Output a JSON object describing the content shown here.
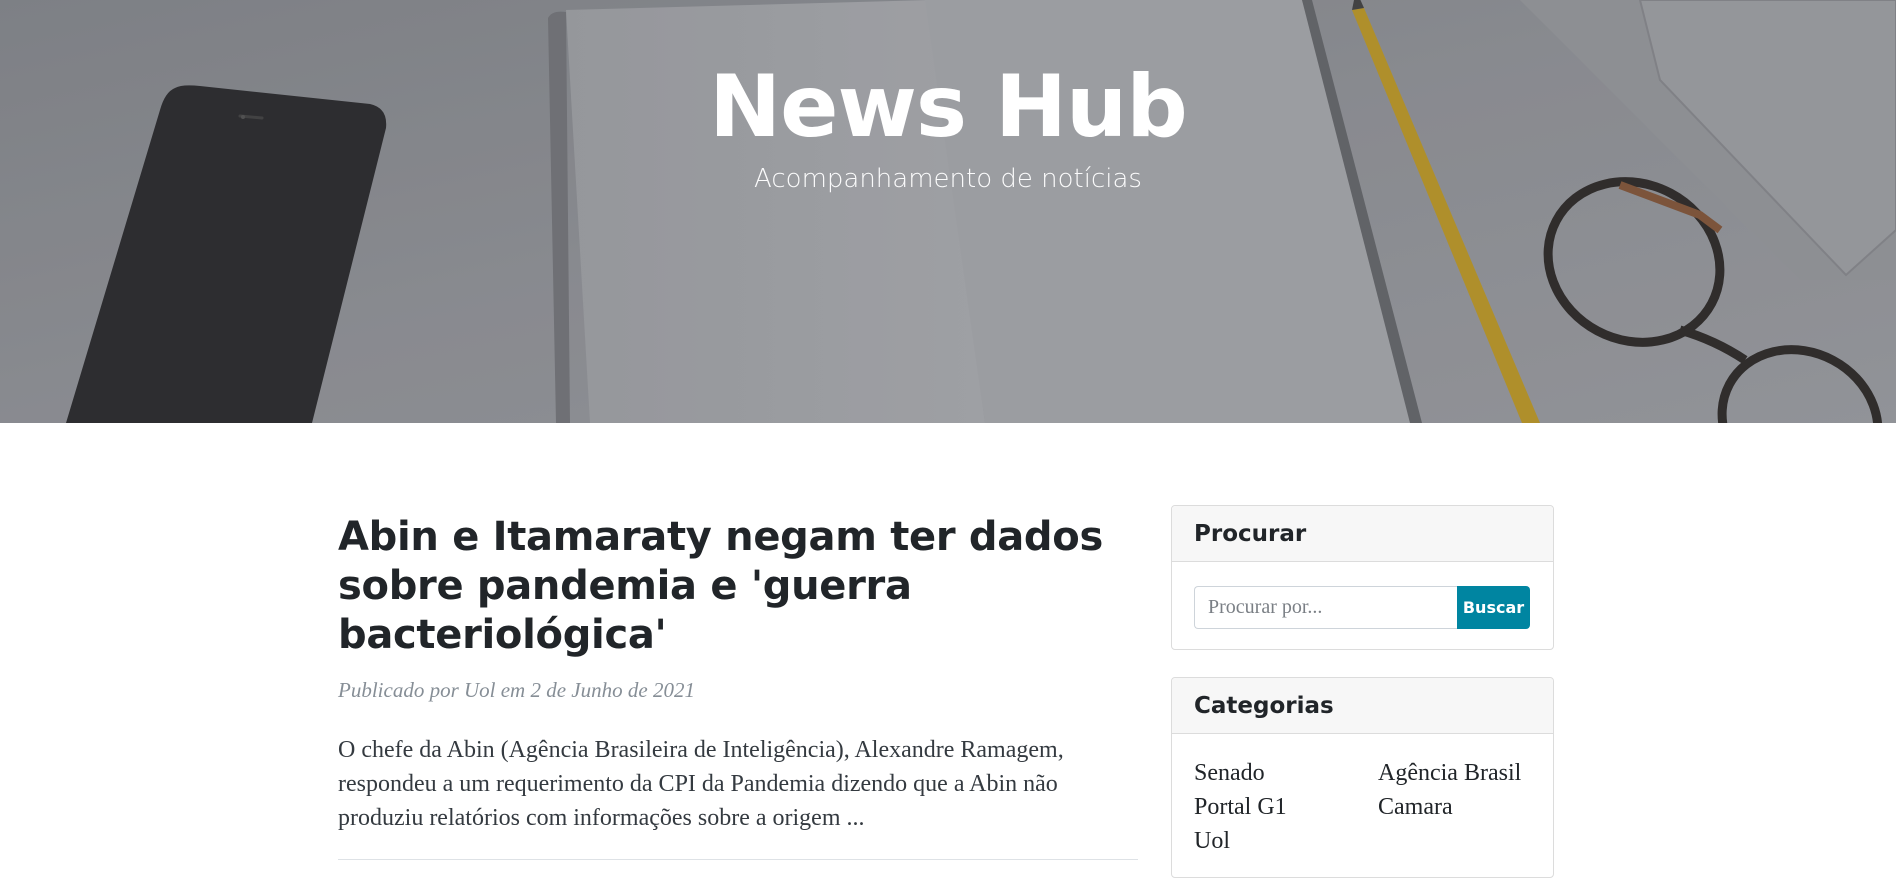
{
  "header": {
    "title": "News Hub",
    "subtitle": "Acompanhamento de notícias"
  },
  "post": {
    "title": "Abin e Itamaraty negam ter dados sobre pandemia e 'guerra bacteriológica'",
    "meta": "Publicado por Uol em 2 de Junho de 2021",
    "excerpt": "O chefe da Abin (Agência Brasileira de Inteligência), Alexandre Ramagem, respondeu a um requerimento da CPI da Pandemia dizendo que a Abin não produziu relatórios com informações sobre a origem ..."
  },
  "sidebar": {
    "search": {
      "heading": "Procurar",
      "placeholder": "Procurar por...",
      "button_label": "Buscar"
    },
    "categories": {
      "heading": "Categorias",
      "items": [
        "Senado",
        "Agência Brasil",
        "Portal G1",
        "Camara",
        "Uol"
      ]
    }
  },
  "colors": {
    "accent": "#0085a1",
    "hero_overlay": "#8a8d92",
    "text": "#212529",
    "meta": "#868e96"
  }
}
